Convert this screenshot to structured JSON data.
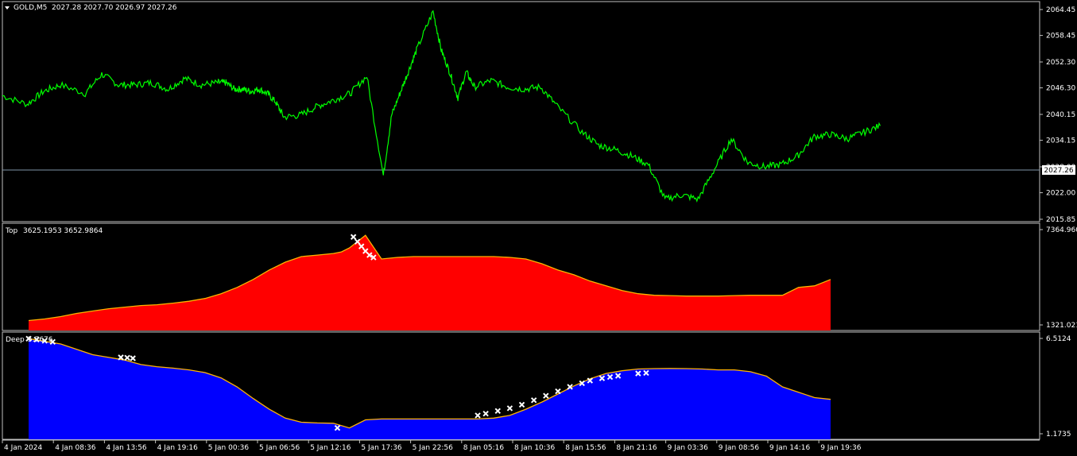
{
  "header": {
    "symbol": "GOLD,M5",
    "ohlc": "2027.28 2027.70 2026.97 2027.26"
  },
  "colors": {
    "price_line": "#00ff00",
    "current_price_line": "#7f96a8",
    "top_fill": "#ff0000",
    "deep_fill": "#0000ff",
    "outline": "#ffb400",
    "marker": "#ffffff",
    "frame": "#c0c0c0"
  },
  "chart_data": [
    {
      "type": "line",
      "name": "price",
      "ylim": [
        2015.85,
        2064.45
      ],
      "yticks": [
        "2064.45",
        "2058.45",
        "2052.30",
        "2046.30",
        "2040.15",
        "2034.15",
        "2028.00",
        "2022.00",
        "2015.85"
      ],
      "current_price": 2027.26,
      "current_price_label": "2027.26",
      "x": [
        0,
        3,
        5,
        7,
        10,
        12,
        14,
        16,
        18,
        20,
        22,
        24,
        26,
        27,
        28,
        29,
        30,
        31,
        32,
        33,
        34,
        36,
        38,
        40,
        42,
        44,
        46,
        47,
        48,
        49,
        50,
        52,
        53,
        54,
        55,
        56,
        57,
        59,
        61,
        63,
        65,
        67,
        70,
        72,
        74,
        76,
        78,
        80,
        82,
        84,
        86,
        88,
        90,
        92,
        94,
        96,
        98,
        100,
        102,
        104,
        106
      ],
      "values": [
        2044.5,
        2042.5,
        2045.5,
        2047,
        2045,
        2049.5,
        2047,
        2047,
        2047.5,
        2046,
        2048.5,
        2047,
        2047.5,
        2047.5,
        2046,
        2046,
        2045.5,
        2046,
        2045,
        2043,
        2039.5,
        2040,
        2042,
        2043.5,
        2045,
        2049,
        2026,
        2040,
        2045,
        2050,
        2055,
        2064,
        2055,
        2050,
        2044,
        2050,
        2046.5,
        2048,
        2046.5,
        2046,
        2046.5,
        2042,
        2036,
        2033,
        2032,
        2030.5,
        2028.5,
        2020.5,
        2021.5,
        2020.5,
        2027.5,
        2034.5,
        2029,
        2028,
        2028.5,
        2030.5,
        2035,
        2035.5,
        2034.5,
        2036,
        2037.5
      ]
    },
    {
      "type": "area",
      "name": "Top",
      "header_values": "3625.1953 3652.9864",
      "ylim": [
        1321.0214,
        7364.9607
      ],
      "yticks": [
        "7364.9607",
        "1321.0214"
      ],
      "x": [
        0,
        2,
        4,
        6,
        8,
        10,
        12,
        14,
        16,
        18,
        20,
        22,
        24,
        26,
        28,
        30,
        32,
        34,
        36,
        38,
        39,
        40,
        42,
        44,
        46,
        48,
        50,
        52,
        54,
        56,
        58,
        60,
        62,
        64,
        66,
        68,
        70,
        72,
        74,
        76,
        78,
        80,
        82,
        84,
        86,
        88,
        90,
        92,
        94,
        96,
        98,
        100
      ],
      "values": [
        1600,
        1700,
        1850,
        2050,
        2200,
        2350,
        2450,
        2550,
        2600,
        2700,
        2820,
        3000,
        3300,
        3700,
        4200,
        4800,
        5300,
        5650,
        5750,
        5850,
        5950,
        6200,
        7000,
        5500,
        5600,
        5650,
        5650,
        5650,
        5650,
        5650,
        5650,
        5600,
        5500,
        5200,
        4800,
        4500,
        4100,
        3800,
        3500,
        3300,
        3200,
        3180,
        3150,
        3150,
        3150,
        3180,
        3200,
        3200,
        3200,
        3700,
        3800,
        4200
      ]
    },
    {
      "type": "area",
      "name": "Deep",
      "header_values": "5.7676",
      "ylim": [
        1.1735,
        6.5124
      ],
      "yticks": [
        "6.5124",
        "1.1735"
      ],
      "x": [
        0,
        2,
        4,
        6,
        8,
        10,
        12,
        14,
        16,
        18,
        20,
        22,
        24,
        26,
        28,
        30,
        32,
        34,
        36,
        38,
        40,
        42,
        44,
        46,
        48,
        50,
        52,
        54,
        56,
        58,
        60,
        62,
        64,
        66,
        68,
        70,
        72,
        74,
        76,
        78,
        80,
        82,
        84,
        86,
        88,
        90,
        92,
        94,
        96,
        98,
        100
      ],
      "values": [
        6.5,
        6.35,
        6.2,
        5.9,
        5.6,
        5.45,
        5.3,
        5.05,
        4.93,
        4.85,
        4.75,
        4.6,
        4.3,
        3.8,
        3.15,
        2.55,
        2.05,
        1.82,
        1.78,
        1.76,
        1.5,
        1.95,
        2.0,
        2.0,
        2.0,
        2.0,
        2.0,
        2.0,
        2.0,
        2.05,
        2.2,
        2.55,
        2.95,
        3.4,
        3.85,
        4.25,
        4.55,
        4.7,
        4.8,
        4.82,
        4.83,
        4.82,
        4.8,
        4.75,
        4.75,
        4.65,
        4.4,
        3.8,
        3.5,
        3.2,
        3.1
      ]
    }
  ],
  "markers_top": [
    [
      40.5,
      6900
    ],
    [
      41,
      6600
    ],
    [
      41.5,
      6300
    ],
    [
      42,
      6000
    ],
    [
      42.5,
      5750
    ],
    [
      43,
      5600
    ]
  ],
  "markers_deep": [
    [
      0,
      6.5
    ],
    [
      1,
      6.45
    ],
    [
      2,
      6.38
    ],
    [
      3,
      6.32
    ],
    [
      11.5,
      5.45
    ],
    [
      12.3,
      5.43
    ],
    [
      13,
      5.4
    ],
    [
      38.5,
      1.5
    ],
    [
      56,
      2.2
    ],
    [
      57,
      2.3
    ],
    [
      58.5,
      2.45
    ],
    [
      60,
      2.6
    ],
    [
      61.5,
      2.8
    ],
    [
      63,
      3.05
    ],
    [
      64.5,
      3.3
    ],
    [
      66,
      3.55
    ],
    [
      67.5,
      3.8
    ],
    [
      69,
      4.0
    ],
    [
      70,
      4.15
    ],
    [
      71.5,
      4.28
    ],
    [
      72.5,
      4.35
    ],
    [
      73.5,
      4.42
    ],
    [
      76,
      4.55
    ],
    [
      77,
      4.58
    ]
  ],
  "xaxis": {
    "labels": [
      "4 Jan 2024",
      "4 Jan 08:36",
      "4 Jan 13:56",
      "4 Jan 19:16",
      "5 Jan 00:36",
      "5 Jan 06:56",
      "5 Jan 12:16",
      "5 Jan 17:36",
      "5 Jan 22:56",
      "8 Jan 05:16",
      "8 Jan 10:36",
      "8 Jan 15:56",
      "8 Jan 21:16",
      "9 Jan 03:36",
      "9 Jan 08:56",
      "9 Jan 14:16",
      "9 Jan 19:36"
    ]
  }
}
